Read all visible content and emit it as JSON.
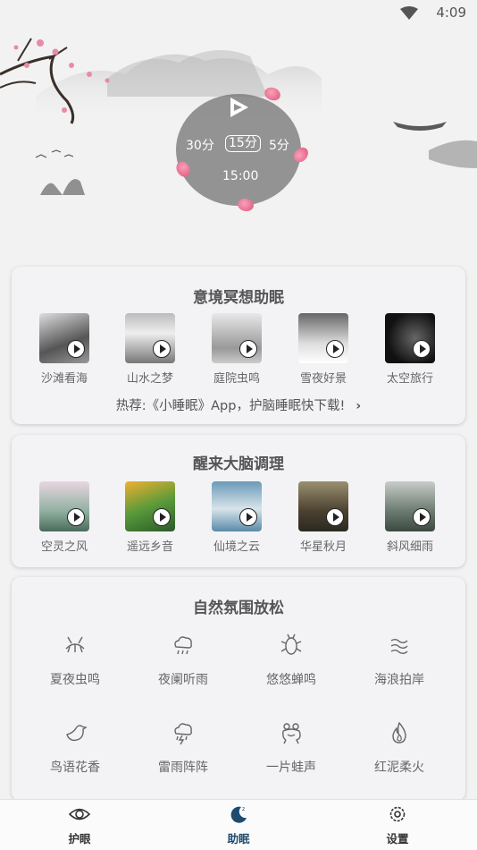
{
  "status": {
    "time": "4:09"
  },
  "player": {
    "durations": [
      "30分",
      "15分",
      "5分"
    ],
    "remaining": "15:00"
  },
  "sections": {
    "meditation": {
      "title": "意境冥想助眠",
      "items": [
        {
          "label": "沙滩看海"
        },
        {
          "label": "山水之梦"
        },
        {
          "label": "庭院虫鸣"
        },
        {
          "label": "雪夜好景"
        },
        {
          "label": "太空旅行"
        }
      ],
      "promo": "热荐:《小睡眠》App，护脑睡眠快下载!"
    },
    "wake": {
      "title": "醒来大脑调理",
      "items": [
        {
          "label": "空灵之风"
        },
        {
          "label": "遥远乡音"
        },
        {
          "label": "仙境之云"
        },
        {
          "label": "华星秋月"
        },
        {
          "label": "斜风细雨"
        }
      ]
    },
    "nature": {
      "title": "自然氛围放松",
      "items": [
        {
          "label": "夏夜虫鸣",
          "icon": "cricket-icon"
        },
        {
          "label": "夜阑听雨",
          "icon": "rain-cloud-icon"
        },
        {
          "label": "悠悠蝉鸣",
          "icon": "cicada-icon"
        },
        {
          "label": "海浪拍岸",
          "icon": "waves-icon"
        },
        {
          "label": "鸟语花香",
          "icon": "bird-icon"
        },
        {
          "label": "雷雨阵阵",
          "icon": "thunderstorm-icon"
        },
        {
          "label": "一片蛙声",
          "icon": "frog-icon"
        },
        {
          "label": "红泥柔火",
          "icon": "fire-icon"
        }
      ]
    }
  },
  "tabs": [
    {
      "label": "护眼",
      "icon": "eye-icon"
    },
    {
      "label": "助眠",
      "icon": "moon-icon",
      "active": true
    },
    {
      "label": "设置",
      "icon": "gear-icon"
    }
  ],
  "colors": {
    "accent": "#1e4a6e",
    "petal": "#e0537b",
    "player": "#6e6e6e"
  }
}
